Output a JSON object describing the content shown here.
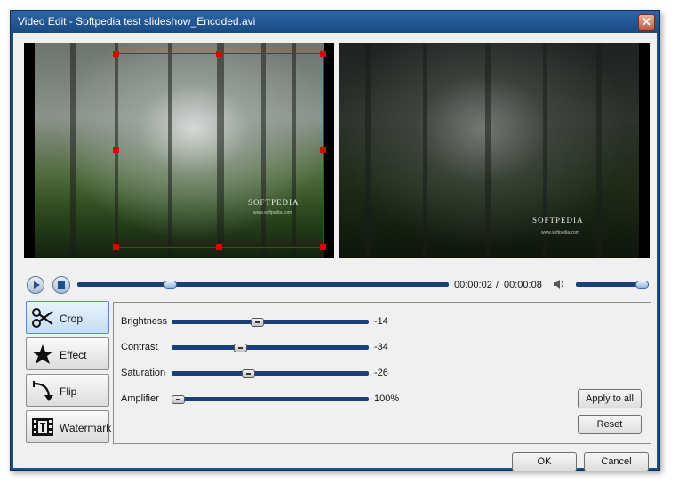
{
  "window": {
    "title": "Video Edit - Softpedia test slideshow_Encoded.avi",
    "close_glyph": "✕"
  },
  "preview": {
    "watermark": "SOFTPEDIA",
    "url": "www.softpedia.com"
  },
  "playback": {
    "current_time": "00:00:02",
    "separator": "/",
    "total_time": "00:00:08",
    "progress": 0.24,
    "volume": 1.0
  },
  "tabs": [
    {
      "label": "Crop",
      "icon": "scissors-icon",
      "active": true
    },
    {
      "label": "Effect",
      "icon": "star-icon",
      "active": false
    },
    {
      "label": "Flip",
      "icon": "flip-arrow-icon",
      "active": false
    },
    {
      "label": "Watermark",
      "icon": "watermark-film-icon",
      "active": false
    }
  ],
  "adjustments": {
    "brightness": {
      "label": "Brightness",
      "value": "-14",
      "position": 0.43
    },
    "contrast": {
      "label": "Contrast",
      "value": "-34",
      "position": 0.34
    },
    "saturation": {
      "label": "Saturation",
      "value": "-26",
      "position": 0.38
    },
    "amplifier": {
      "label": "Amplifier",
      "value": "100%",
      "position": 0.0
    }
  },
  "buttons": {
    "apply_to_all": "Apply to all",
    "reset": "Reset",
    "ok": "OK",
    "cancel": "Cancel"
  },
  "colors": {
    "title_bar": "#1d4f86",
    "track": "#1b3f7a",
    "crop_frame": "#e00000"
  }
}
